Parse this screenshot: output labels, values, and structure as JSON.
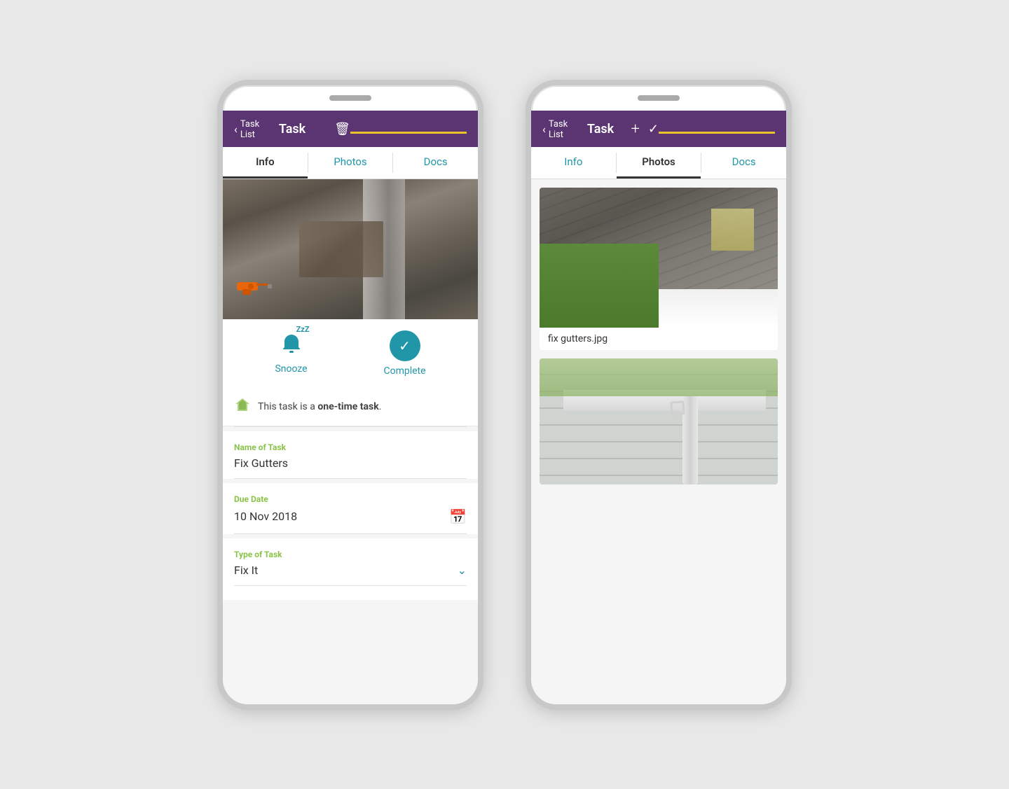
{
  "phone1": {
    "nav": {
      "back_label": "Task List",
      "title": "Task",
      "action_icon": "🗑"
    },
    "tabs": [
      {
        "label": "Info",
        "active": true
      },
      {
        "label": "Photos",
        "active": false
      },
      {
        "label": "Docs",
        "active": false
      }
    ],
    "actions": {
      "snooze_label": "Snooze",
      "complete_label": "Complete"
    },
    "one_time_text_1": "This task is a ",
    "one_time_bold": "one-time task",
    "one_time_text_2": ".",
    "fields": [
      {
        "label": "Name of Task",
        "value": "Fix Gutters",
        "type": "text"
      },
      {
        "label": "Due Date",
        "value": "10 Nov 2018",
        "type": "date"
      },
      {
        "label": "Type of Task",
        "value": "Fix It",
        "type": "dropdown"
      }
    ]
  },
  "phone2": {
    "nav": {
      "back_label": "Task List",
      "title": "Task",
      "action_plus": "+",
      "action_check": "✓"
    },
    "tabs": [
      {
        "label": "Info",
        "active": false
      },
      {
        "label": "Photos",
        "active": true
      },
      {
        "label": "Docs",
        "active": false
      }
    ],
    "photos": [
      {
        "filename": "fix gutters.jpg"
      },
      {
        "filename": ""
      }
    ]
  },
  "colors": {
    "purple": "#5b3472",
    "teal": "#2196a8",
    "yellow": "#e8c42a",
    "green": "#8bc34a"
  }
}
